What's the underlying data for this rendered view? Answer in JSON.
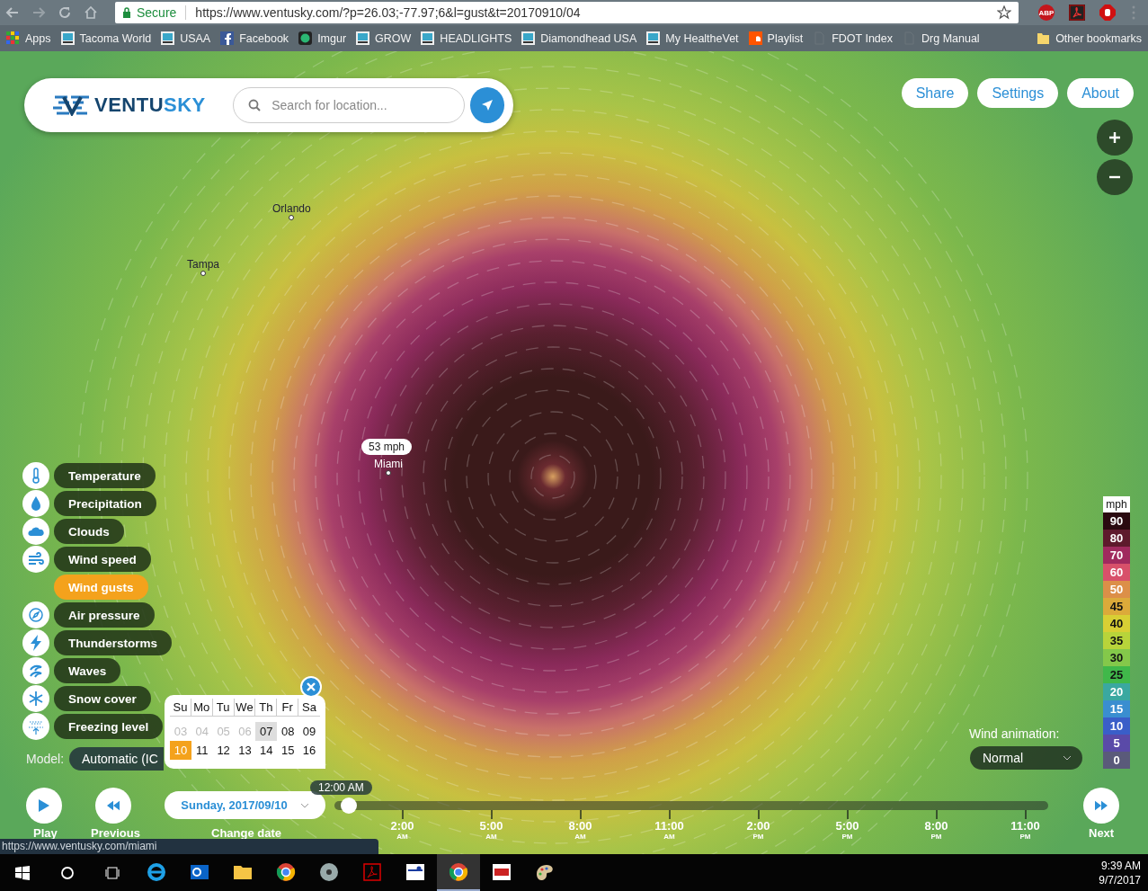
{
  "browser": {
    "secure_label": "Secure",
    "url": "https://www.ventusky.com/?p=26.03;-77.97;6&l=gust&t=20170910/04",
    "extension_abp": "ABP",
    "bookmarks": [
      {
        "label": "Apps",
        "kind": "apps"
      },
      {
        "label": "Tacoma World",
        "kind": "site"
      },
      {
        "label": "USAA",
        "kind": "site"
      },
      {
        "label": "Facebook",
        "kind": "facebook"
      },
      {
        "label": "Imgur",
        "kind": "dot"
      },
      {
        "label": "GROW",
        "kind": "site"
      },
      {
        "label": "HEADLIGHTS",
        "kind": "site"
      },
      {
        "label": "Diamondhead USA",
        "kind": "site"
      },
      {
        "label": "My HealtheVet",
        "kind": "site"
      },
      {
        "label": "Playlist",
        "kind": "music"
      },
      {
        "label": "FDOT Index",
        "kind": "page"
      },
      {
        "label": "Drg Manual",
        "kind": "page"
      }
    ],
    "other_bookmarks": "Other bookmarks"
  },
  "site": {
    "logo": {
      "part_1": "VENTU",
      "part_2": "SKY"
    },
    "search": {
      "placeholder": "Search for location..."
    },
    "header_buttons": [
      "Share",
      "Settings",
      "About"
    ],
    "map": {
      "cities": [
        {
          "name": "Orlando",
          "kind": "dot-below"
        },
        {
          "name": "Tampa",
          "kind": "dot-below"
        },
        {
          "name": "Miami",
          "kind": "dot-below"
        }
      ],
      "tooltip": "53 mph"
    },
    "layers": [
      {
        "label": "Temperature",
        "kind": "thermometer",
        "selected": false
      },
      {
        "label": "Precipitation",
        "kind": "drop",
        "selected": false
      },
      {
        "label": "Clouds",
        "kind": "cloud",
        "selected": false
      },
      {
        "label": "Wind speed",
        "kind": "wind",
        "selected": false
      },
      {
        "label": "Wind gusts",
        "selected": true
      },
      {
        "label": "Air pressure",
        "kind": "pressure",
        "selected": false
      },
      {
        "label": "Thunderstorms",
        "kind": "bolt",
        "selected": false
      },
      {
        "label": "Waves",
        "kind": "waves",
        "selected": false
      },
      {
        "label": "Snow cover",
        "kind": "snow",
        "selected": false
      },
      {
        "label": "Freezing level",
        "kind": "freezing",
        "selected": false
      }
    ],
    "model": {
      "label": "Model:",
      "value": "Automatic (IC"
    },
    "calendar": {
      "weekdays": [
        "Su",
        "Mo",
        "Tu",
        "We",
        "Th",
        "Fr",
        "Sa"
      ],
      "weeks": [
        [
          {
            "day": "03",
            "disabled": true,
            "today": false,
            "selected": false
          },
          {
            "day": "04",
            "disabled": true,
            "today": false,
            "selected": false
          },
          {
            "day": "05",
            "disabled": true,
            "today": false,
            "selected": false
          },
          {
            "day": "06",
            "disabled": true,
            "today": false,
            "selected": false
          },
          {
            "day": "07",
            "disabled": false,
            "today": true,
            "selected": false
          },
          {
            "day": "08",
            "disabled": false,
            "today": false,
            "selected": false
          },
          {
            "day": "09",
            "disabled": false,
            "today": false,
            "selected": false
          }
        ],
        [
          {
            "day": "10",
            "disabled": false,
            "today": false,
            "selected": true
          },
          {
            "day": "11",
            "disabled": false,
            "today": false,
            "selected": false
          },
          {
            "day": "12",
            "disabled": false,
            "today": false,
            "selected": false
          },
          {
            "day": "13",
            "disabled": false,
            "today": false,
            "selected": false
          },
          {
            "day": "14",
            "disabled": false,
            "today": false,
            "selected": false
          },
          {
            "day": "15",
            "disabled": false,
            "today": false,
            "selected": false
          },
          {
            "day": "16",
            "disabled": false,
            "today": false,
            "selected": false
          }
        ]
      ]
    },
    "date_select": "Sunday, 2017/09/10",
    "controls": {
      "play": "Play",
      "previous": "Previous",
      "change_date": "Change date",
      "next": "Next"
    },
    "timeline": {
      "current_time": "12:00 AM",
      "level": 0.01,
      "ticks": [
        {
          "time": "2:00",
          "period": "AM"
        },
        {
          "time": "5:00",
          "period": "AM"
        },
        {
          "time": "8:00",
          "period": "AM"
        },
        {
          "time": "11:00",
          "period": "AM"
        },
        {
          "time": "2:00",
          "period": "PM"
        },
        {
          "time": "5:00",
          "period": "PM"
        },
        {
          "time": "8:00",
          "period": "PM"
        },
        {
          "time": "11:00",
          "period": "PM"
        }
      ]
    },
    "wind_animation": {
      "label": "Wind animation:",
      "value": "Normal"
    },
    "legend": {
      "unit": "mph",
      "steps": [
        {
          "value": "90",
          "color": "#2a0a10"
        },
        {
          "value": "80",
          "color": "#5e1a2c"
        },
        {
          "value": "70",
          "color": "#a02a5e"
        },
        {
          "value": "60",
          "color": "#d8506a"
        },
        {
          "value": "50",
          "color": "#dc8f48"
        },
        {
          "value": "45",
          "color": "#dcaa3a"
        },
        {
          "value": "40",
          "color": "#d8cf34"
        },
        {
          "value": "35",
          "color": "#b8d43a"
        },
        {
          "value": "30",
          "color": "#84c84a"
        },
        {
          "value": "25",
          "color": "#40b84a"
        },
        {
          "value": "20",
          "color": "#3aa8a0"
        },
        {
          "value": "15",
          "color": "#3a8ed0"
        },
        {
          "value": "10",
          "color": "#3a5ec8"
        },
        {
          "value": "5",
          "color": "#5a4aa8"
        },
        {
          "value": "0",
          "color": "#5a5a7a"
        }
      ]
    }
  },
  "status_url": "https://www.ventusky.com/miami",
  "taskbar": {
    "apps": [
      {
        "kind": "ie",
        "active": false
      },
      {
        "kind": "outlook",
        "active": false
      },
      {
        "kind": "folder",
        "active": false
      },
      {
        "kind": "chrome",
        "active": false
      },
      {
        "kind": "disc",
        "active": false
      },
      {
        "kind": "pdf",
        "active": false
      },
      {
        "kind": "tool",
        "active": false
      },
      {
        "kind": "chrome",
        "active": true
      },
      {
        "kind": "ssa",
        "active": false
      },
      {
        "kind": "paint",
        "active": false
      }
    ],
    "time": "9:39 AM",
    "date": "9/7/2017"
  }
}
